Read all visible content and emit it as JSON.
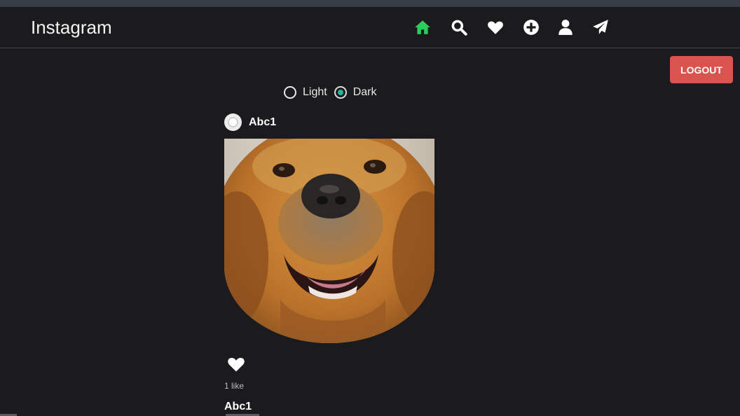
{
  "app": {
    "title": "Instagram"
  },
  "nav": {
    "icons": [
      "home-icon",
      "search-icon",
      "heart-icon",
      "plus-circle-icon",
      "user-icon",
      "send-icon"
    ],
    "active_color": "#2ecc5a",
    "icon_color": "#ffffff"
  },
  "header": {
    "logout_label": "LOGOUT",
    "logout_color": "#d9534f"
  },
  "theme_toggle": {
    "options": [
      {
        "label": "Light",
        "selected": false
      },
      {
        "label": "Dark",
        "selected": true
      }
    ],
    "selected_color": "#2bb39a"
  },
  "post": {
    "username": "Abc1",
    "image": "golden-retriever-photo",
    "likes_text": "1 like",
    "caption_user": "Abc1"
  }
}
